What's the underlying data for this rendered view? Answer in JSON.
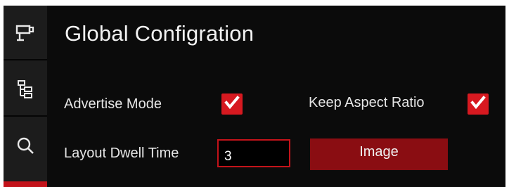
{
  "sidebar": {
    "items": [
      {
        "icon": "camera-icon"
      },
      {
        "icon": "tree-icon"
      },
      {
        "icon": "search-icon"
      }
    ],
    "active_color": "#c3131a"
  },
  "page": {
    "title": "Global Configration"
  },
  "settings": {
    "advertise_mode": {
      "label": "Advertise Mode",
      "checked": true
    },
    "keep_aspect_ratio": {
      "label": "Keep Aspect Ratio",
      "checked": true
    },
    "layout_dwell_time": {
      "label": "Layout Dwell Time",
      "value": "3"
    },
    "image_button_label": "Image"
  },
  "colors": {
    "checkbox": "#d71920",
    "button": "#8a0d12",
    "input_border": "#c3131a"
  }
}
